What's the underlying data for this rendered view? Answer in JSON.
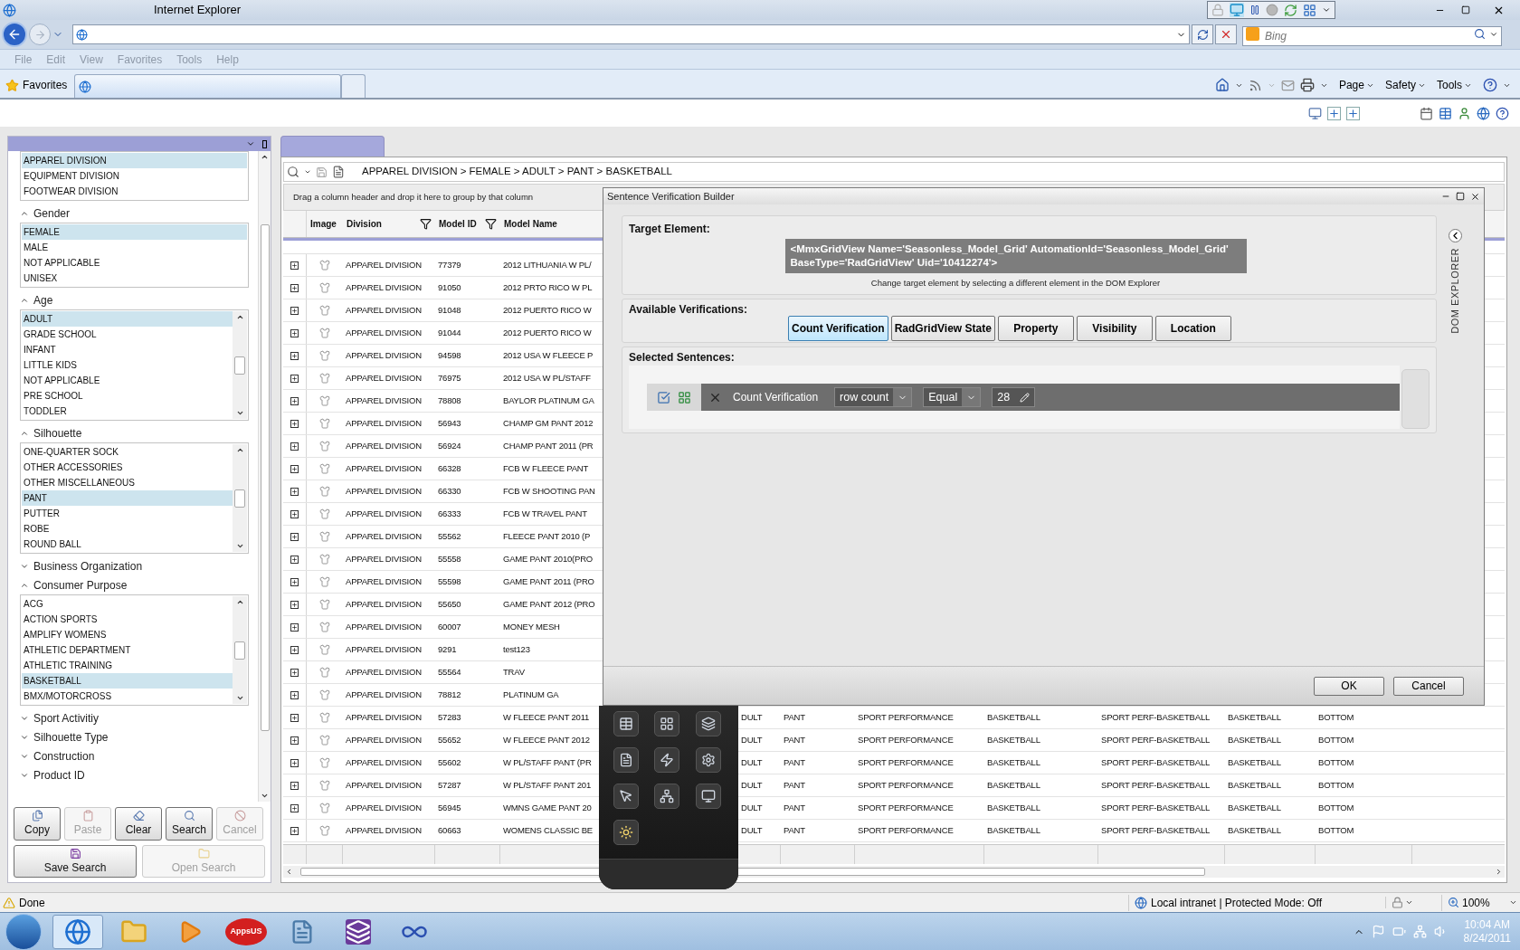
{
  "browser": {
    "title": "Internet Explorer",
    "search_placeholder": "Bing",
    "menu": [
      {
        "label": "File",
        "disabled": true
      },
      {
        "label": "Edit",
        "disabled": true
      },
      {
        "label": "View",
        "disabled": true
      },
      {
        "label": "Favorites",
        "disabled": true
      },
      {
        "label": "Tools",
        "disabled": true
      },
      {
        "label": "Help",
        "disabled": true
      }
    ],
    "favorites_label": "Favorites",
    "tabs": [
      {
        "selected": true
      },
      {
        "selected": false
      }
    ],
    "commands": [
      "Page",
      "Safety",
      "Tools"
    ]
  },
  "filter_panel": {
    "sections": [
      {
        "items": [
          {
            "label": "APPAREL DIVISION",
            "selected": true
          },
          {
            "label": "EQUIPMENT DIVISION",
            "selected": false
          },
          {
            "label": "FOOTWEAR DIVISION",
            "selected": false
          }
        ]
      },
      {
        "heading": "Gender",
        "expanded": true,
        "items": [
          {
            "label": "FEMALE",
            "selected": true
          },
          {
            "label": "MALE",
            "selected": false
          },
          {
            "label": "NOT APPLICABLE",
            "selected": false
          },
          {
            "label": "UNISEX",
            "selected": false
          }
        ]
      },
      {
        "heading": "Age",
        "expanded": true,
        "items": [
          {
            "label": "ADULT",
            "selected": true
          },
          {
            "label": "GRADE SCHOOL",
            "selected": false
          },
          {
            "label": "INFANT",
            "selected": false
          },
          {
            "label": "LITTLE KIDS",
            "selected": false
          },
          {
            "label": "NOT APPLICABLE",
            "selected": false
          },
          {
            "label": "PRE SCHOOL",
            "selected": false
          },
          {
            "label": "TODDLER",
            "selected": false
          }
        ]
      },
      {
        "heading": "Silhouette",
        "expanded": true,
        "items": [
          {
            "label": "ONE-QUARTER SOCK",
            "selected": false
          },
          {
            "label": "OTHER ACCESSORIES",
            "selected": false
          },
          {
            "label": "OTHER MISCELLANEOUS",
            "selected": false
          },
          {
            "label": "PANT",
            "selected": true
          },
          {
            "label": "PUTTER",
            "selected": false
          },
          {
            "label": "ROBE",
            "selected": false
          },
          {
            "label": "ROUND BALL",
            "selected": false
          }
        ]
      },
      {
        "heading": "Business Organization",
        "expanded": false
      },
      {
        "heading": "Consumer Purpose",
        "expanded": true,
        "items": [
          {
            "label": "ACG",
            "selected": false
          },
          {
            "label": "ACTION SPORTS",
            "selected": false
          },
          {
            "label": "AMPLIFY WOMENS",
            "selected": false
          },
          {
            "label": "ATHLETIC DEPARTMENT",
            "selected": false
          },
          {
            "label": "ATHLETIC TRAINING",
            "selected": false
          },
          {
            "label": "BASKETBALL",
            "selected": true
          },
          {
            "label": "BMX/MOTORCROSS",
            "selected": false
          }
        ]
      },
      {
        "heading": "Sport Activitiy",
        "expanded": false
      },
      {
        "heading": "Silhouette Type",
        "expanded": false
      },
      {
        "heading": "Construction",
        "expanded": false
      },
      {
        "heading": "Product ID",
        "expanded": false
      }
    ],
    "buttons": [
      {
        "kind": "copy",
        "label": "Copy",
        "disabled": false
      },
      {
        "kind": "paste",
        "label": "Paste",
        "disabled": true
      },
      {
        "kind": "clear",
        "label": "Clear",
        "disabled": false
      },
      {
        "kind": "search",
        "label": "Search",
        "disabled": false
      },
      {
        "kind": "cancel",
        "label": "Cancel",
        "disabled": true
      }
    ],
    "wide_buttons": [
      {
        "kind": "save",
        "label": "Save Search",
        "disabled": false
      },
      {
        "kind": "open",
        "label": "Open Search",
        "disabled": true
      }
    ]
  },
  "grid": {
    "breadcrumb": "APPAREL DIVISION > FEMALE > ADULT > PANT > BASKETBALL",
    "group_hint": "Drag a column header and drop it here to group by that column",
    "columns": [
      {
        "label": "Image"
      },
      {
        "label": "Division",
        "filter": true
      },
      {
        "label": "Model ID",
        "filter": true
      },
      {
        "label": "Model Name"
      }
    ],
    "rows": [
      {
        "cells": [
          "",
          "APPAREL DIVISION",
          "77379",
          "2012 LITHUANIA W PL/"
        ]
      },
      {
        "cells": [
          "",
          "APPAREL DIVISION",
          "91050",
          "2012 PRTO RICO W PL"
        ]
      },
      {
        "cells": [
          "",
          "APPAREL DIVISION",
          "91048",
          "2012 PUERTO RICO W"
        ]
      },
      {
        "cells": [
          "",
          "APPAREL DIVISION",
          "91044",
          "2012 PUERTO RICO W"
        ]
      },
      {
        "cells": [
          "",
          "APPAREL DIVISION",
          "94598",
          "2012 USA W FLEECE P"
        ]
      },
      {
        "cells": [
          "",
          "APPAREL DIVISION",
          "76975",
          "2012 USA W PL/STAFF"
        ]
      },
      {
        "cells": [
          "",
          "APPAREL DIVISION",
          "78808",
          "BAYLOR PLATINUM GA"
        ]
      },
      {
        "cells": [
          "",
          "APPAREL DIVISION",
          "56943",
          "CHAMP GM PANT 2012"
        ]
      },
      {
        "cells": [
          "",
          "APPAREL DIVISION",
          "56924",
          "CHAMP PANT 2011 (PR"
        ]
      },
      {
        "cells": [
          "",
          "APPAREL DIVISION",
          "66328",
          "FCB W FLEECE PANT"
        ]
      },
      {
        "cells": [
          "",
          "APPAREL DIVISION",
          "66330",
          "FCB W SHOOTING PAN"
        ]
      },
      {
        "cells": [
          "",
          "APPAREL DIVISION",
          "66333",
          "FCB W TRAVEL PANT"
        ]
      },
      {
        "cells": [
          "",
          "APPAREL DIVISION",
          "55562",
          "FLEECE PANT 2010 (P"
        ]
      },
      {
        "cells": [
          "",
          "APPAREL DIVISION",
          "55558",
          "GAME PANT 2010(PRO"
        ]
      },
      {
        "cells": [
          "",
          "APPAREL DIVISION",
          "55598",
          "GAME PANT 2011 (PRO"
        ]
      },
      {
        "cells": [
          "",
          "APPAREL DIVISION",
          "55650",
          "GAME PANT 2012 (PRO"
        ]
      },
      {
        "cells": [
          "",
          "APPAREL DIVISION",
          "60007",
          "MONEY MESH"
        ]
      },
      {
        "cells": [
          "",
          "APPAREL DIVISION",
          "9291",
          "test123"
        ]
      },
      {
        "cells": [
          "",
          "APPAREL DIVISION",
          "55564",
          "TRAV"
        ]
      },
      {
        "cells": [
          "",
          "APPAREL DIVISION",
          "78812",
          "PLATINUM GA"
        ]
      },
      {
        "cells": [
          "",
          "APPAREL DIVISION",
          "57283",
          "W FLEECE PANT 2011",
          "DULT",
          "PANT",
          "SPORT PERFORMANCE",
          "BASKETBALL",
          "SPORT PERF-BASKETBALL",
          "BASKETBALL",
          "BOTTOM"
        ]
      },
      {
        "cells": [
          "",
          "APPAREL DIVISION",
          "55652",
          "W FLEECE PANT 2012",
          "DULT",
          "PANT",
          "SPORT PERFORMANCE",
          "BASKETBALL",
          "SPORT PERF-BASKETBALL",
          "BASKETBALL",
          "BOTTOM"
        ]
      },
      {
        "cells": [
          "",
          "APPAREL DIVISION",
          "55602",
          "W PL/STAFF PANT (PR",
          "DULT",
          "PANT",
          "SPORT PERFORMANCE",
          "BASKETBALL",
          "SPORT PERF-BASKETBALL",
          "BASKETBALL",
          "BOTTOM"
        ]
      },
      {
        "cells": [
          "",
          "APPAREL DIVISION",
          "57287",
          "W PL/STAFF PANT 201",
          "DULT",
          "PANT",
          "SPORT PERFORMANCE",
          "BASKETBALL",
          "SPORT PERF-BASKETBALL",
          "BASKETBALL",
          "BOTTOM"
        ]
      },
      {
        "cells": [
          "",
          "APPAREL DIVISION",
          "56945",
          "WMNS GAME PANT 20",
          "DULT",
          "PANT",
          "SPORT PERFORMANCE",
          "BASKETBALL",
          "SPORT PERF-BASKETBALL",
          "BASKETBALL",
          "BOTTOM"
        ]
      },
      {
        "cells": [
          "",
          "APPAREL DIVISION",
          "60663",
          "WOMENS CLASSIC BE",
          "DULT",
          "PANT",
          "SPORT PERFORMANCE",
          "BASKETBALL",
          "SPORT PERF-BASKETBALL",
          "BASKETBALL",
          "BOTTOM"
        ]
      }
    ]
  },
  "dialog": {
    "title": "Sentence Verification Builder",
    "target_label": "Target Element:",
    "target_element": "<MmxGridView Name='Seasonless_Model_Grid' AutomationId='Seasonless_Model_Grid' BaseType='RadGridView' Uid='10412274'>",
    "target_hint": "Change target element by selecting a different element in the DOM Explorer",
    "verifications_label": "Available Verifications:",
    "verifications": [
      {
        "label": "Count Verification",
        "selected": true
      },
      {
        "label": "RadGridView State",
        "selected": false
      },
      {
        "label": "Property",
        "selected": false
      },
      {
        "label": "Visibility",
        "selected": false
      },
      {
        "label": "Location",
        "selected": false
      }
    ],
    "sentences_label": "Selected Sentences:",
    "sentences": [
      {
        "verification": "Count Verification",
        "property": "row count",
        "operator": "Equal",
        "value": "28"
      }
    ],
    "side_tab": "DOM EXPLORER",
    "buttons": [
      "OK",
      "Cancel"
    ]
  },
  "status_bar": {
    "text": "Done",
    "zone": "Local intranet | Protected Mode: Off",
    "zoom": "100%"
  },
  "taskbar": {
    "apps": [
      {
        "kind": "browser",
        "selected": true
      },
      {
        "kind": "folder",
        "selected": false
      },
      {
        "kind": "media",
        "selected": false
      },
      {
        "kind": "badge",
        "label": "AppsUS",
        "selected": false
      },
      {
        "kind": "notes",
        "selected": false
      },
      {
        "kind": "studio",
        "selected": false
      },
      {
        "kind": "infinity",
        "selected": false
      }
    ],
    "time": "10:04 AM",
    "date": "8/24/2011"
  }
}
